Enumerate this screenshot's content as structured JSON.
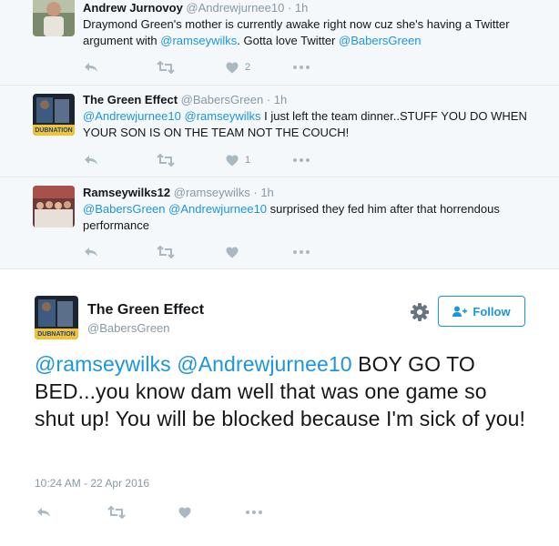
{
  "replies": [
    {
      "name": "Andrew Jurnovoy",
      "handle": "@Andrewjurnee10",
      "sep": "·",
      "time": "1h",
      "text_parts": [
        "Draymond Green's mother is currently awake right now cuz she's having a Twitter argument with ",
        "@ramseywilks",
        ". Gotta love Twitter ",
        "@BabersGreen"
      ],
      "like_count": "2"
    },
    {
      "name": "The Green Effect",
      "handle": "@BabersGreen",
      "sep": "·",
      "time": "1h",
      "text_parts": [
        "@Andrewjurnee10",
        " ",
        "@ramseywilks",
        " I just left the team dinner..STUFF YOU DO WHEN YOUR SON IS ON THE TEAM NOT THE COUCH!"
      ],
      "like_count": "1"
    },
    {
      "name": "Ramseywilks12",
      "handle": "@ramseywilks",
      "sep": "·",
      "time": "1h",
      "text_parts": [
        "@BabersGreen",
        " ",
        "@Andrewjurnee10",
        " surprised they fed him after that horrendous performance"
      ],
      "like_count": ""
    }
  ],
  "main": {
    "name": "The Green Effect",
    "handle": "@BabersGreen",
    "follow_label": "Follow",
    "text_parts": [
      "@ramseywilks",
      " ",
      "@Andrewjurnee10",
      " BOY GO TO BED...you know dam well that was one game so shut up! You will be blocked because I'm sick of you!"
    ],
    "timestamp": "10:24 AM - 22 Apr 2016"
  },
  "avatar_label": "DUBNATION",
  "icons": {
    "reply": "reply-icon",
    "retweet": "retweet-icon",
    "like": "heart-icon",
    "more": "more-icon",
    "settings": "gear-icon",
    "follow": "add-user-icon"
  },
  "colors": {
    "link": "#1b95e0",
    "action": "#aab8c2",
    "reply_bg": "#f5f8fa"
  }
}
